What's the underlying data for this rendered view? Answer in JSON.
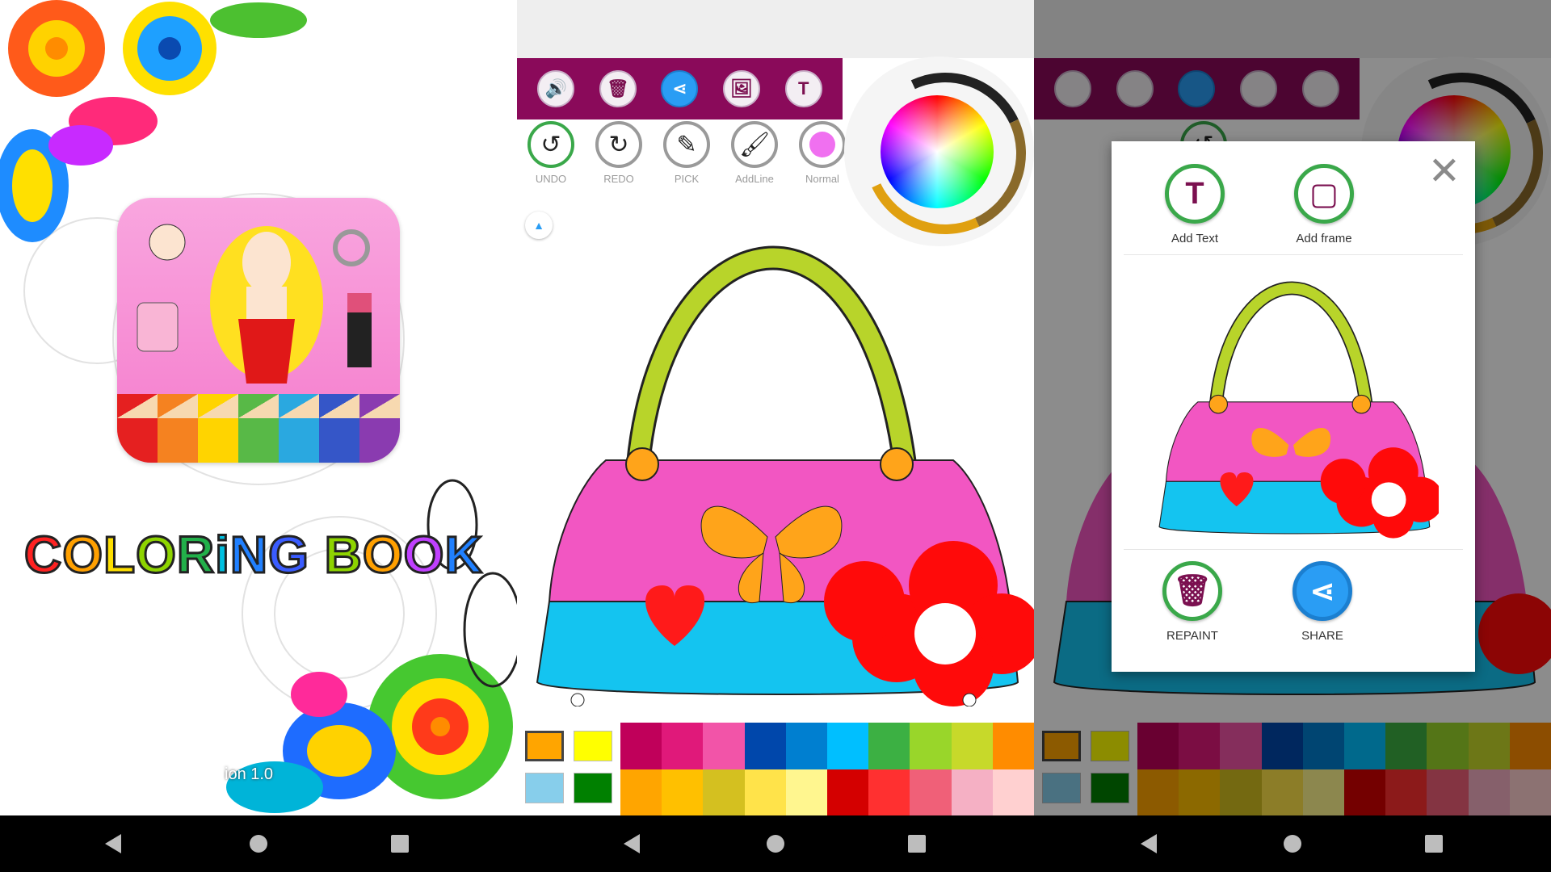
{
  "splash": {
    "title": "COLORiNG BOOK",
    "title_letters": [
      {
        "ch": "C",
        "color": "#ff2222"
      },
      {
        "ch": "O",
        "color": "#ffa000"
      },
      {
        "ch": "L",
        "color": "#ffe000"
      },
      {
        "ch": "O",
        "color": "#8ed400"
      },
      {
        "ch": "R",
        "color": "#22b04a"
      },
      {
        "ch": "i",
        "color": "#00c0e0"
      },
      {
        "ch": "N",
        "color": "#2080ff"
      },
      {
        "ch": "G",
        "color": "#3a5cff"
      },
      {
        "ch": " ",
        "color": "#000000"
      },
      {
        "ch": "B",
        "color": "#8ed400"
      },
      {
        "ch": "O",
        "color": "#ffa000"
      },
      {
        "ch": "O",
        "color": "#c040ff"
      },
      {
        "ch": "K",
        "color": "#2080ff"
      }
    ],
    "version": "ion 1.0",
    "pencil_colors": [
      "#e52020",
      "#f58220",
      "#ffd400",
      "#58b947",
      "#2aa8e0",
      "#3556c8",
      "#8a3bb0"
    ]
  },
  "toolbar": {
    "buttons": [
      {
        "name": "sound",
        "glyph": "🔊"
      },
      {
        "name": "delete",
        "glyph": "🗑"
      },
      {
        "name": "share",
        "glyph": "⋖"
      },
      {
        "name": "save-image",
        "glyph": "🖼"
      },
      {
        "name": "text",
        "glyph": "T"
      }
    ]
  },
  "tools": [
    {
      "name": "undo",
      "label": "UNDO",
      "glyph": "↺",
      "color": "green"
    },
    {
      "name": "redo",
      "label": "REDO",
      "glyph": "↻",
      "color": "grey"
    },
    {
      "name": "pick",
      "label": "PICK",
      "glyph": "✎",
      "color": "grey"
    },
    {
      "name": "addline",
      "label": "AddLine",
      "glyph": "🖌",
      "color": "grey"
    },
    {
      "name": "normal",
      "label": "Normal",
      "glyph": "",
      "color": "grey"
    }
  ],
  "collapse_glyph": "▲",
  "palette": {
    "selected": [
      "#ffa500",
      "#ffff00",
      "#87ceeb",
      "#008000"
    ],
    "grid": [
      "#c0005a",
      "#e0197a",
      "#f254a8",
      "#0047ab",
      "#007fd0",
      "#00bfff",
      "#3cb043",
      "#99d62a",
      "#c7d92a",
      "#ff8c00",
      "#ffa500",
      "#ffc000",
      "#d4c020",
      "#ffe34a",
      "#fff68f",
      "#d40000",
      "#ff3030",
      "#f06078",
      "#f5b0c4",
      "#ffd0d0"
    ]
  },
  "dialog": {
    "close_glyph": "✕",
    "add_text_label": "Add Text",
    "add_text_glyph": "T",
    "add_frame_label": "Add frame",
    "add_frame_glyph": "▢",
    "repaint_label": "REPAINT",
    "repaint_glyph": "🗑",
    "share_label": "SHARE",
    "share_glyph": "⋖"
  },
  "navbar": {
    "back": "back",
    "home": "home",
    "recent": "recent"
  },
  "colors": {
    "toolbar_bg": "#8a0a5a",
    "bag_pink": "#f256c2",
    "bag_blue": "#14c4f0",
    "bag_handle": "#b8d42a",
    "butterfly": "#ffa41a",
    "flower": "#ff0a0a",
    "heart": "#ff1a1a"
  }
}
